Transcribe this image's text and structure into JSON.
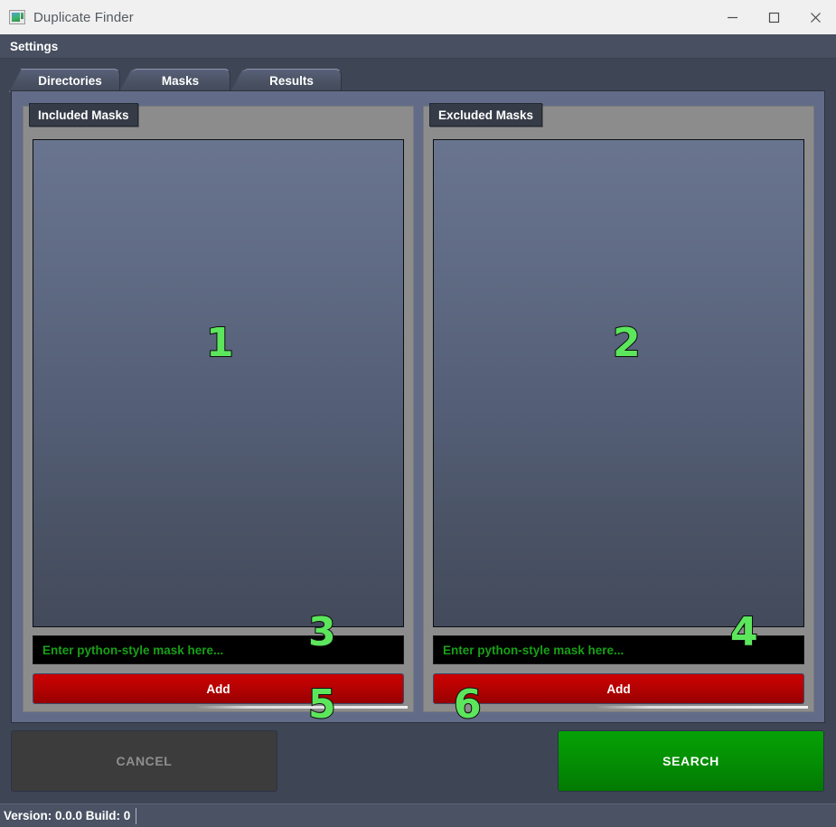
{
  "window": {
    "title": "Duplicate Finder",
    "icon": "app-picture-icon",
    "controls": {
      "minimize": "minimize-icon",
      "maximize": "maximize-icon",
      "close": "close-icon"
    }
  },
  "menubar": {
    "items": [
      {
        "label": "Settings"
      }
    ]
  },
  "tabs": [
    {
      "label": "Directories",
      "selected": false
    },
    {
      "label": "Masks",
      "selected": true
    },
    {
      "label": "Results",
      "selected": false
    }
  ],
  "groups": {
    "included": {
      "title": "Included Masks",
      "list_items": [],
      "input": {
        "value": "",
        "placeholder": "Enter python-style mask here..."
      },
      "add_label": "Add"
    },
    "excluded": {
      "title": "Excluded Masks",
      "list_items": [],
      "input": {
        "value": "",
        "placeholder": "Enter python-style mask here..."
      },
      "add_label": "Add"
    }
  },
  "actions": {
    "cancel_label": "CANCEL",
    "cancel_enabled": false,
    "search_label": "SEARCH",
    "search_enabled": true
  },
  "statusbar": {
    "text": "Version: 0.0.0 Build: 0"
  },
  "annotations": [
    {
      "id": "1",
      "label": "1"
    },
    {
      "id": "2",
      "label": "2"
    },
    {
      "id": "3",
      "label": "3"
    },
    {
      "id": "4",
      "label": "4"
    },
    {
      "id": "5",
      "label": "5"
    },
    {
      "id": "6",
      "label": "6"
    }
  ],
  "colors": {
    "accent_green": "#049104",
    "danger_red": "#b60202",
    "window_chrome": "#3e4656",
    "panel": "#626c88",
    "group": "#8c8c8c",
    "input_bg": "#000000",
    "input_text": "#17a017",
    "annotation": "#5ce65c"
  }
}
